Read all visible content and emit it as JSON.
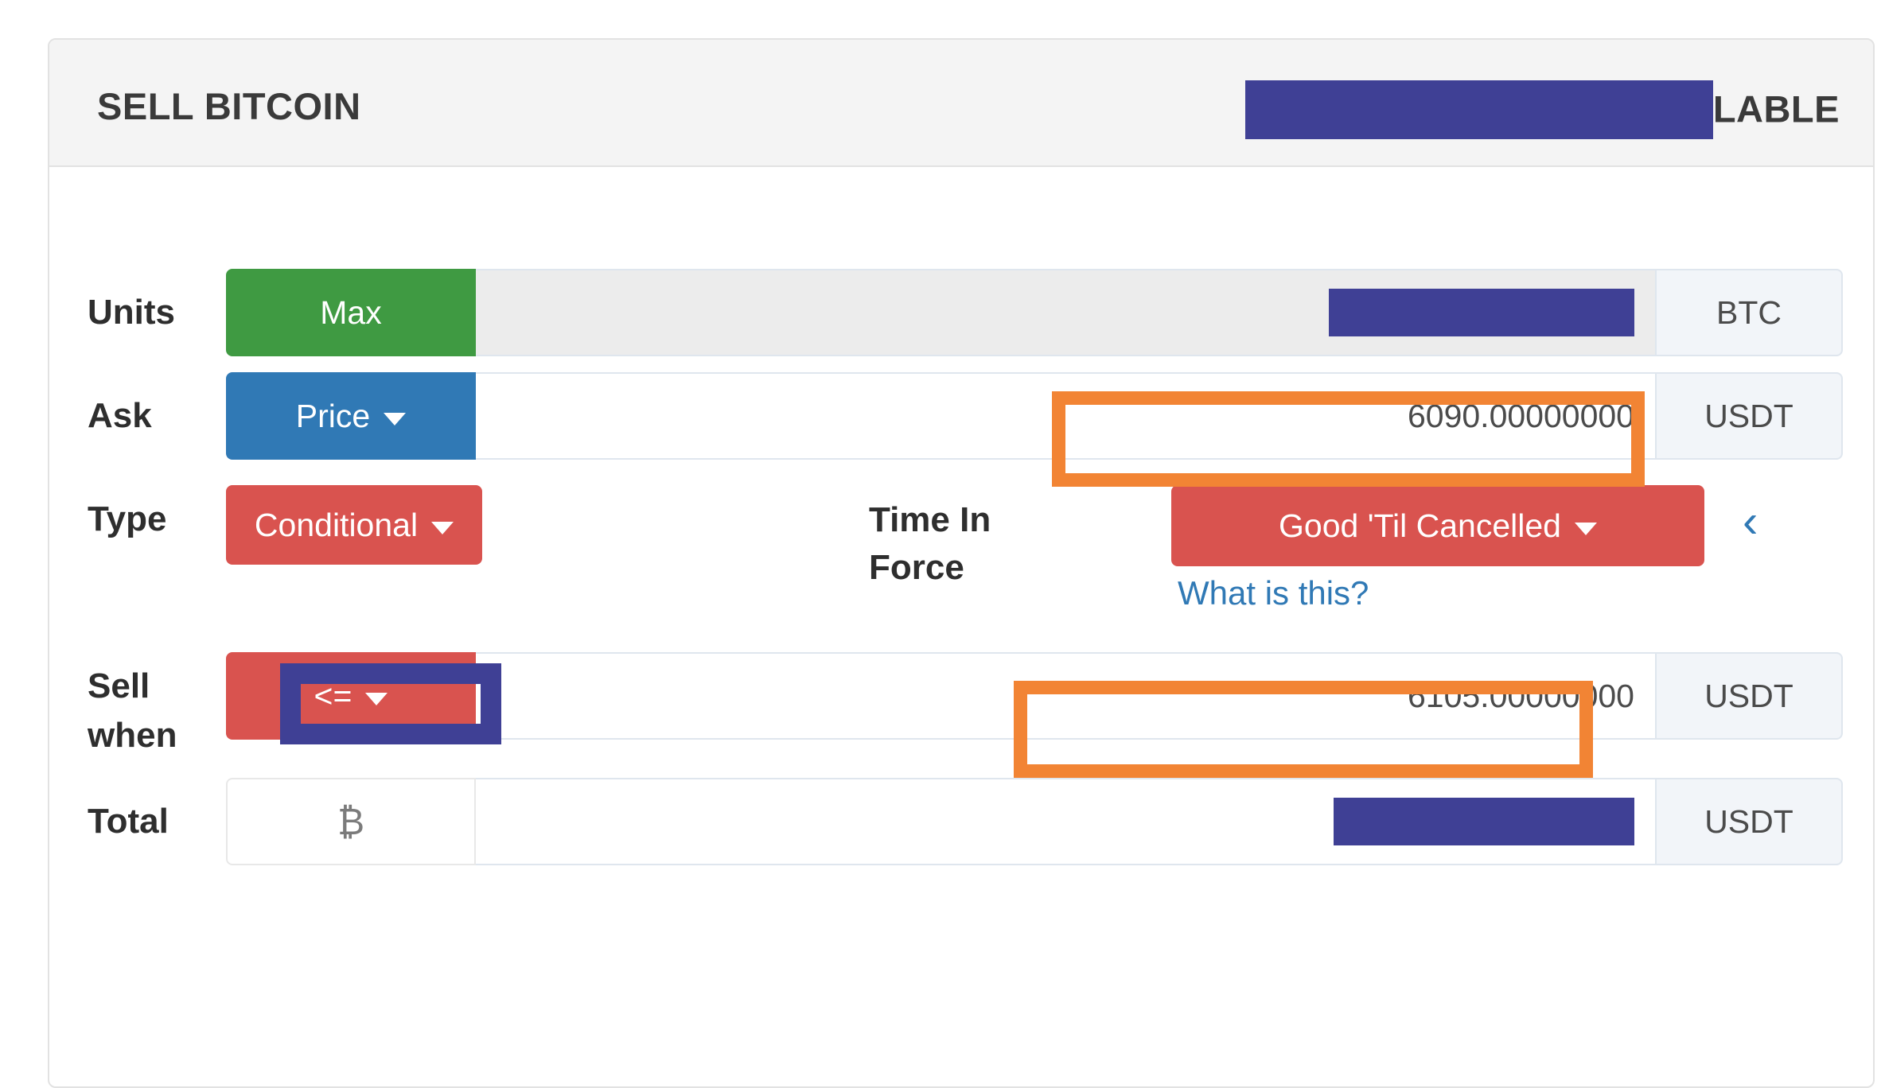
{
  "panel": {
    "title": "SELL BITCOIN",
    "header_right_suffix": "LABLE",
    "header_right_redacted": true
  },
  "rows": {
    "units": {
      "label": "Units",
      "button_label": "Max",
      "button_color": "#3f9a42",
      "value": "",
      "value_redacted": true,
      "currency": "BTC",
      "input_disabled": true
    },
    "ask": {
      "label": "Ask",
      "button_label": "Price",
      "button_color": "#3079b5",
      "has_caret": true,
      "value": "6090.00000000",
      "currency": "USDT"
    },
    "type": {
      "label": "Type",
      "button_label": "Conditional",
      "button_color": "#d9534f",
      "has_caret": true,
      "time_in_force_label": "Time In Force",
      "time_in_force_value": "Good 'Til Cancelled",
      "time_in_force_color": "#d9534f",
      "what_is_this": "What is this?",
      "chevron": "‹"
    },
    "sell_when": {
      "label": "Sell when",
      "operator": "<=",
      "operator_color": "#d9534f",
      "has_caret": true,
      "value": "6105.00000000",
      "currency": "USDT"
    },
    "total": {
      "label": "Total",
      "symbol": "₿",
      "value": "",
      "value_redacted": true,
      "currency": "USDT"
    }
  },
  "annotations": {
    "highlight_color": "#f28434",
    "redaction_color": "#3f4095",
    "orange_boxes": [
      "ask-price-field",
      "sell-when-price-field"
    ],
    "indigo_boxes": [
      "sell-when-operator-button"
    ]
  }
}
